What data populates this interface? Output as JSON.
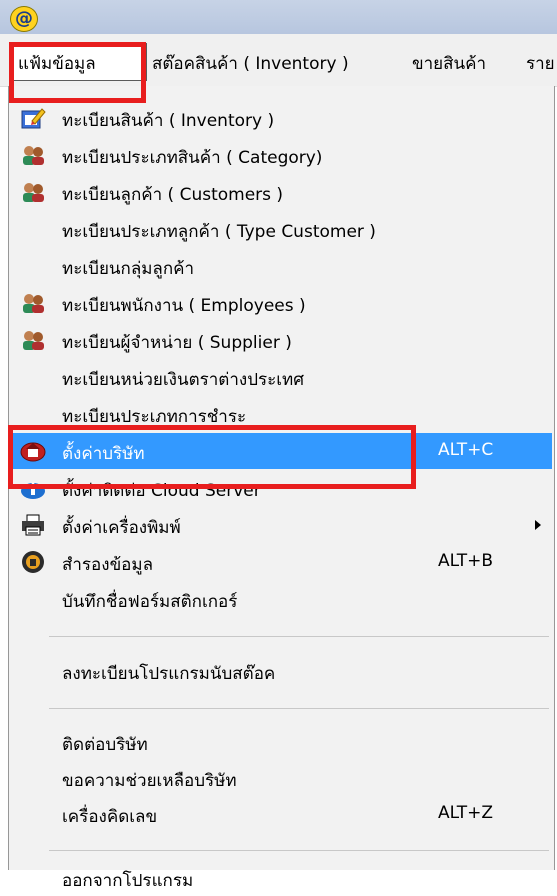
{
  "window": {
    "icon_glyph": "@"
  },
  "menubar": {
    "items": [
      {
        "label": "แฟ้มข้อมูล"
      },
      {
        "label": "สต๊อคสินค้า ( Inventory )"
      },
      {
        "label": "ขายสินค้า"
      },
      {
        "label": "ราย"
      }
    ]
  },
  "dropdown": {
    "items": [
      {
        "label": "ทะเบียนสินค้า ( Inventory )",
        "icon": "edit-form-icon"
      },
      {
        "label": "ทะเบียนประเภทสินค้า ( Category)",
        "icon": "people-icon"
      },
      {
        "label": "ทะเบียนลูกค้า ( Customers )",
        "icon": "people-icon"
      },
      {
        "label": "ทะเบียนประเภทลูกค้า ( Type Customer )"
      },
      {
        "label": "ทะเบียนกลุ่มลูกค้า"
      },
      {
        "label": "ทะเบียนพนักงาน ( Employees )",
        "icon": "people-icon"
      },
      {
        "label": "ทะเบียนผู้จำหน่าย ( Supplier )",
        "icon": "people-icon"
      },
      {
        "label": "ทะเบียนหน่วยเงินตราต่างประเทศ"
      },
      {
        "label": "ทะเบียนประเภทการชำระ"
      },
      {
        "label": "ตั้งค่าบริษัท",
        "shortcut": "ALT+C",
        "icon": "company-icon",
        "selected": true
      },
      {
        "label": "ตั้งค่าติดต่อ Cloud Server",
        "icon": "cloud-upload-icon"
      },
      {
        "label": "ตั้งค่าเครื่องพิมพ์",
        "icon": "printer-icon",
        "submenu": true
      },
      {
        "label": "สำรองข้อมูล",
        "shortcut": "ALT+B",
        "icon": "backup-icon"
      },
      {
        "label": "บันทึกชื่อฟอร์มสติกเกอร์"
      },
      {
        "label": "ลงทะเบียนโปรแกรมนับสต๊อค"
      },
      {
        "label": "ติดต่อบริษัท"
      },
      {
        "label": "ขอความช่วยเหลือบริษัท"
      },
      {
        "label": "เครื่องคิดเลข",
        "shortcut": "ALT+Z"
      },
      {
        "label": "ออกจากโปรแกรม"
      }
    ]
  },
  "colors": {
    "selection": "#3399ff",
    "annotation": "#e81e1e"
  }
}
